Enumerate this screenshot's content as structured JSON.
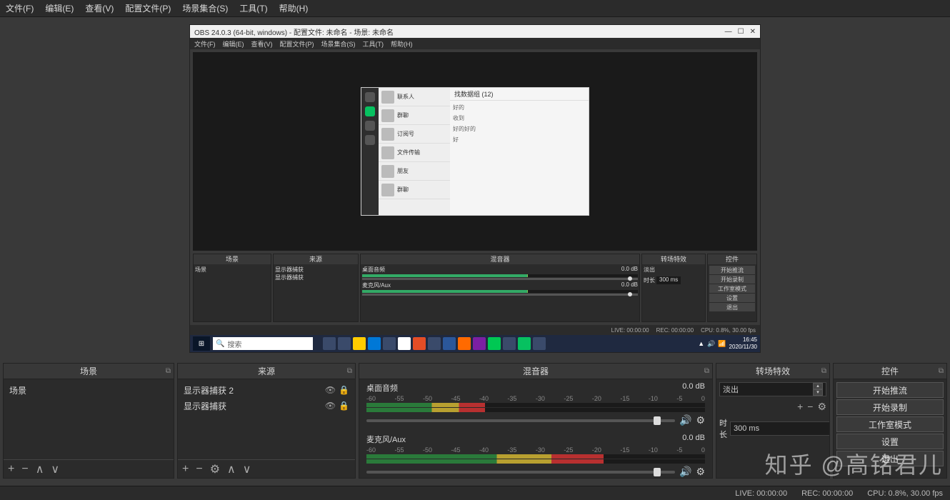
{
  "menubar": {
    "file": "文件(F)",
    "edit": "编辑(E)",
    "view": "查看(V)",
    "profile": "配置文件(P)",
    "scene_collection": "场景集合(S)",
    "tools": "工具(T)",
    "help": "帮助(H)"
  },
  "nested": {
    "title": "OBS 24.0.3 (64-bit, windows) - 配置文件: 未命名 - 场景: 未命名",
    "menubar": {
      "file": "文件(F)",
      "edit": "编辑(E)",
      "view": "查看(V)",
      "profile": "配置文件(P)",
      "scene_collection": "场景集合(S)",
      "tools": "工具(T)",
      "help": "帮助(H)"
    },
    "chat_header": "找数据组 (12)",
    "panels": {
      "scenes": "场景",
      "sources": "来源",
      "mixer": "混音器",
      "transitions": "转场特效",
      "controls": "控件"
    },
    "scene_item": "场景",
    "source_items": [
      "显示器捕获",
      "显示器捕获"
    ],
    "mixer_labels": {
      "desktop": "桌面音频",
      "mic": "麦克风/Aux"
    },
    "mixer_db": "0.0 dB",
    "trans_fade": "淡出",
    "trans_duration_label": "时长",
    "trans_duration_value": "300 ms",
    "ctrl_buttons": [
      "开始推流",
      "开始录制",
      "工作室模式",
      "设置",
      "退出"
    ],
    "status": {
      "live": "LIVE: 00:00:00",
      "rec": "REC: 00:00:00",
      "cpu": "CPU: 0.8%, 30.00 fps"
    },
    "taskbar": {
      "search": "搜索",
      "time": "16:45",
      "date": "2020/11/30"
    }
  },
  "panels": {
    "scenes": {
      "title": "场景",
      "items": [
        "场景"
      ]
    },
    "sources": {
      "title": "来源",
      "items": [
        {
          "name": "显示器捕获 2",
          "visible": true,
          "locked": true
        },
        {
          "name": "显示器捕获",
          "visible": true,
          "locked": true
        }
      ]
    },
    "mixer": {
      "title": "混音器",
      "channels": [
        {
          "name": "桌面音频",
          "db": "0.0 dB"
        },
        {
          "name": "麦克风/Aux",
          "db": "0.0 dB"
        }
      ],
      "ticks": [
        "-60",
        "-55",
        "-50",
        "-45",
        "-40",
        "-35",
        "-30",
        "-25",
        "-20",
        "-15",
        "-10",
        "-5",
        "0"
      ]
    },
    "transitions": {
      "title": "转场特效",
      "selected": "淡出",
      "duration_label": "时长",
      "duration_value": "300 ms"
    },
    "controls": {
      "title": "控件",
      "buttons": [
        "开始推流",
        "开始录制",
        "工作室模式",
        "设置",
        "退出"
      ]
    }
  },
  "statusbar": {
    "live": "LIVE: 00:00:00",
    "rec": "REC: 00:00:00",
    "cpu": "CPU: 0.8%, 30.00 fps"
  },
  "watermark": "知乎 @高铭君儿",
  "icons": {
    "add": "+",
    "remove": "−",
    "up": "∧",
    "down": "∨",
    "gear": "⚙",
    "eye": "👁",
    "lock": "🔒",
    "speaker": "🔊",
    "undock": "⧉",
    "spin_up": "▴",
    "spin_down": "▾",
    "search": "🔍"
  }
}
